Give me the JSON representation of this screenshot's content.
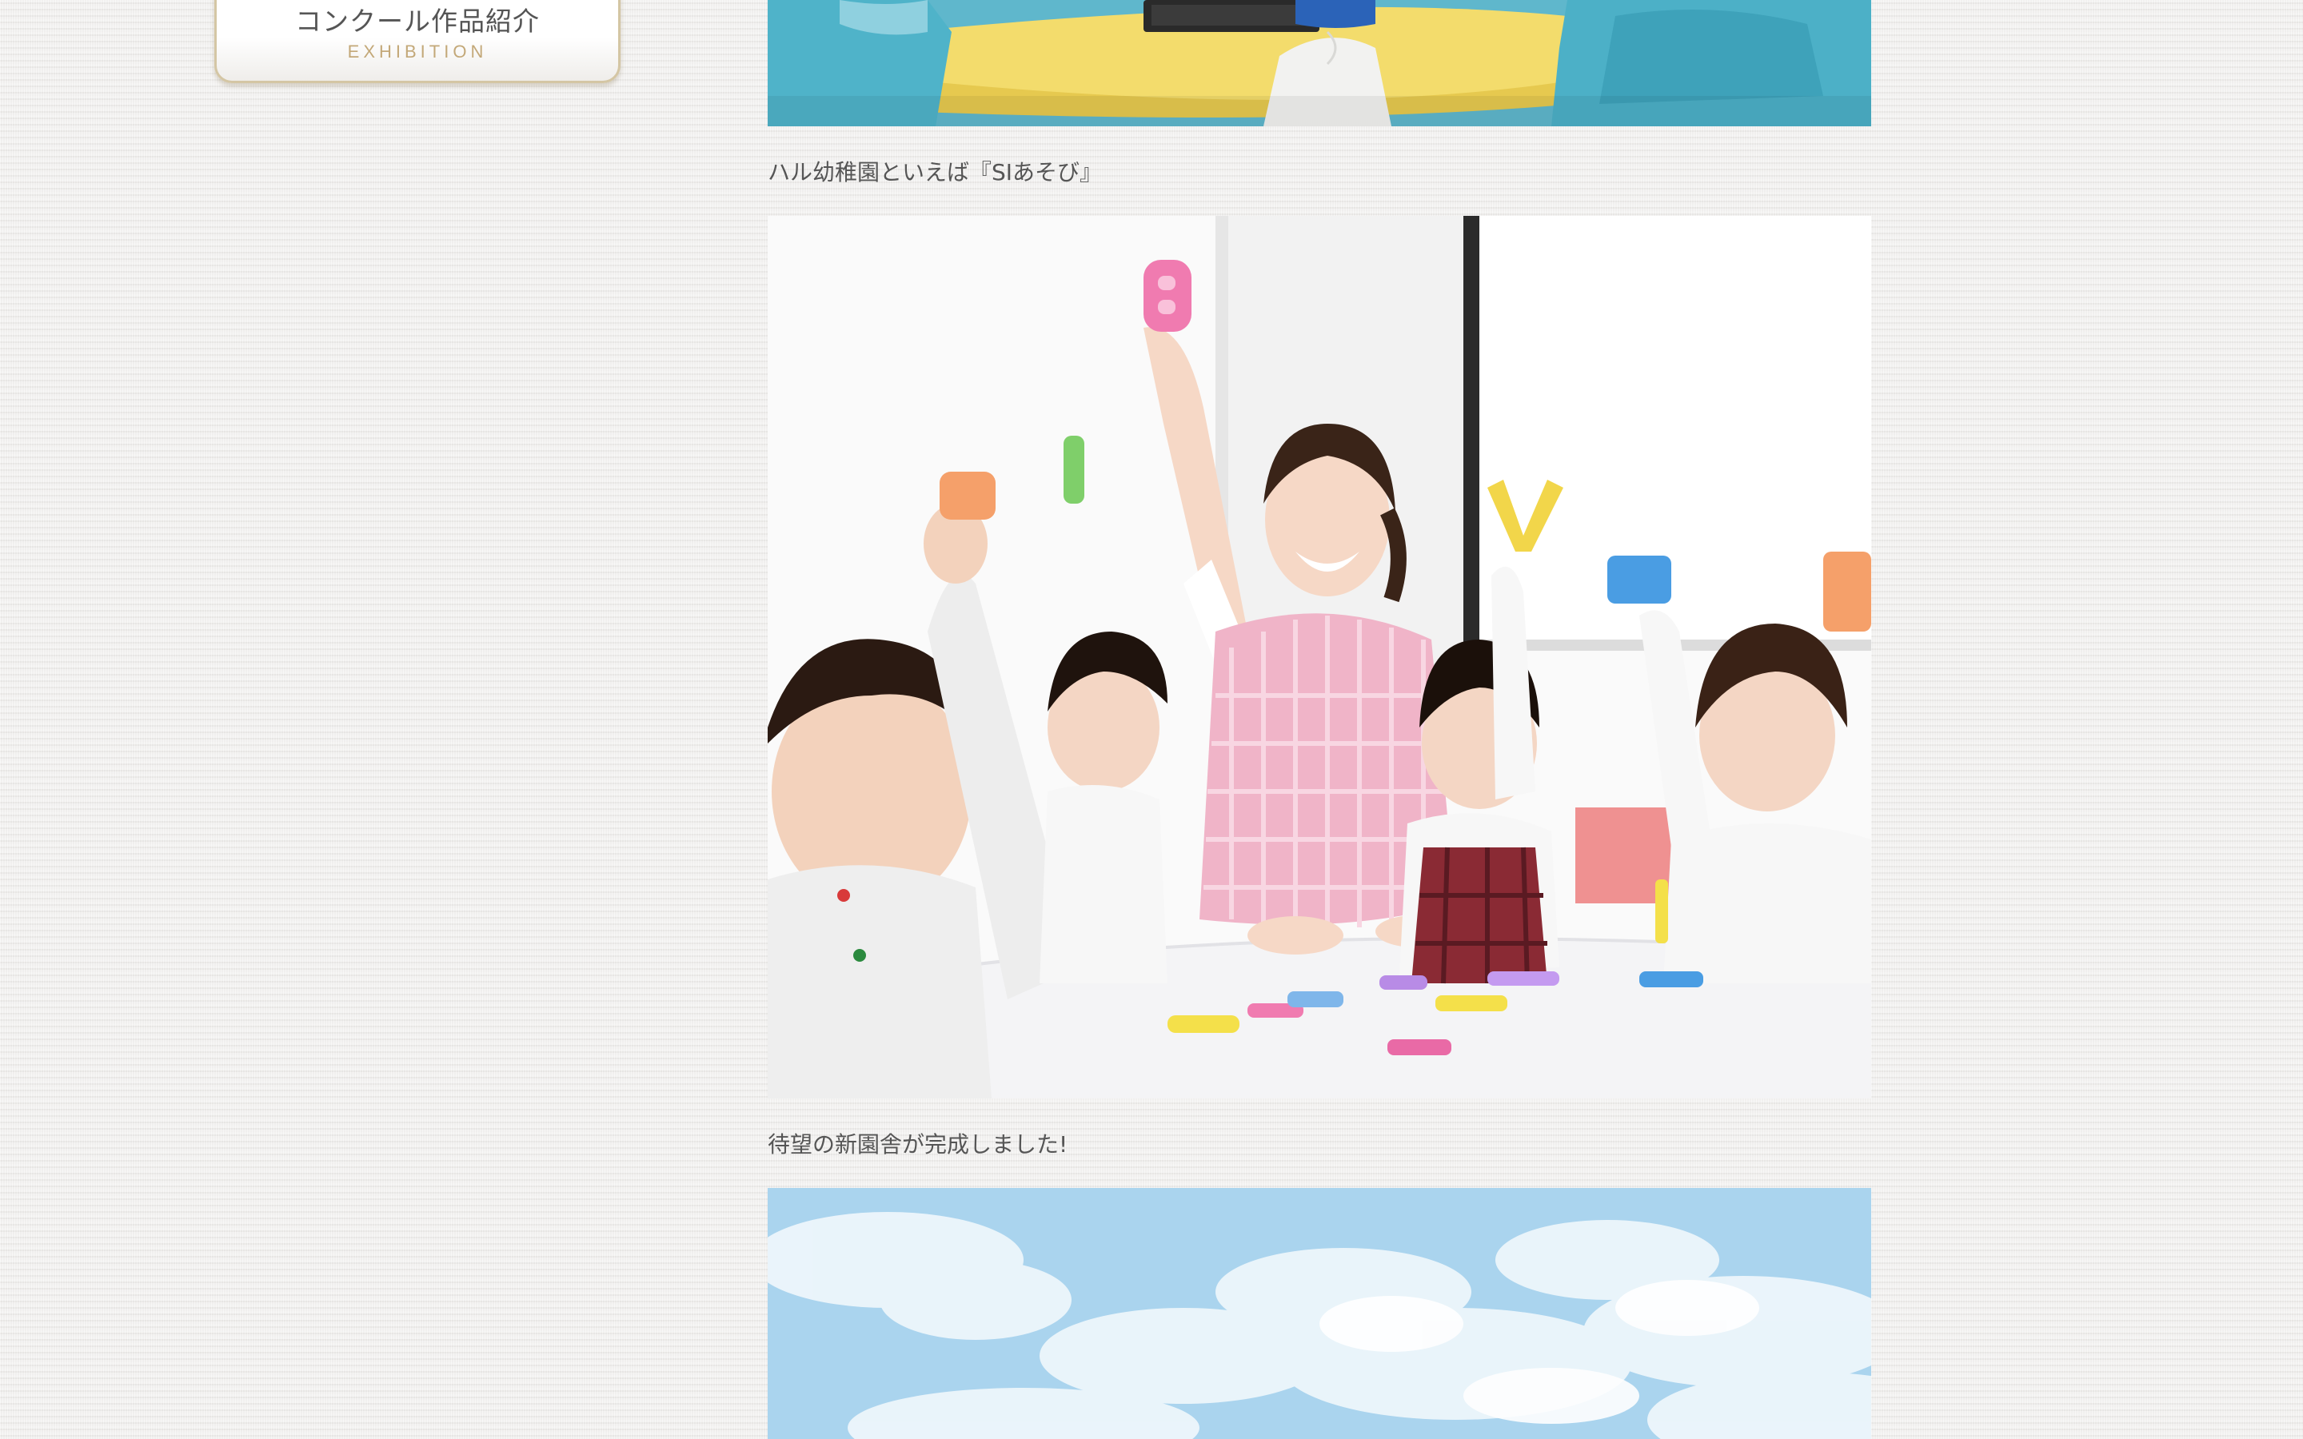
{
  "sidebar": {
    "nav_item": {
      "title": "コンクール作品紹介",
      "subtitle": "EXHIBITION"
    }
  },
  "main": {
    "posts": [
      {
        "image": "children-at-computer-table-photo",
        "caption": "ハル幼稚園といえば『SIあそび』"
      },
      {
        "image": "teacher-and-children-raising-letter-blocks-photo",
        "caption": "待望の新園舎が完成しました!"
      },
      {
        "image": "blue-sky-clouds-photo",
        "caption": ""
      }
    ]
  },
  "colors": {
    "text": "#555555",
    "accent_gold": "#c3a878",
    "card_border": "#d4c6a4",
    "background": "#f3f2f1"
  }
}
